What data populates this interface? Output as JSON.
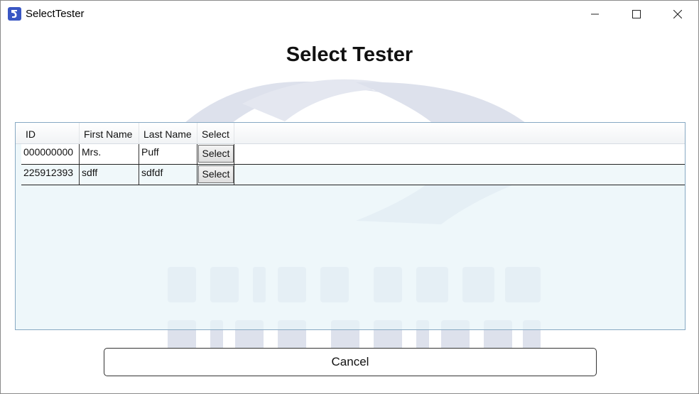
{
  "window": {
    "title": "SelectTester"
  },
  "page": {
    "heading": "Select Tester"
  },
  "grid": {
    "columns": [
      "ID",
      "First Name",
      "Last Name",
      "Select"
    ],
    "rows": [
      {
        "id": "000000000",
        "first_name": "Mrs.",
        "last_name": "Puff",
        "select_label": "Select"
      },
      {
        "id": "225912393",
        "first_name": "sdff",
        "last_name": "sdfdf",
        "select_label": "Select"
      }
    ]
  },
  "footer": {
    "cancel_label": "Cancel"
  },
  "icons": {
    "app": "app-logo-icon",
    "minimize": "minimize-icon",
    "maximize": "maximize-icon",
    "close": "close-icon"
  },
  "colors": {
    "grid_background": "#e8f4f8",
    "grid_border": "#87a9c3",
    "watermark": "#dde1ec"
  }
}
